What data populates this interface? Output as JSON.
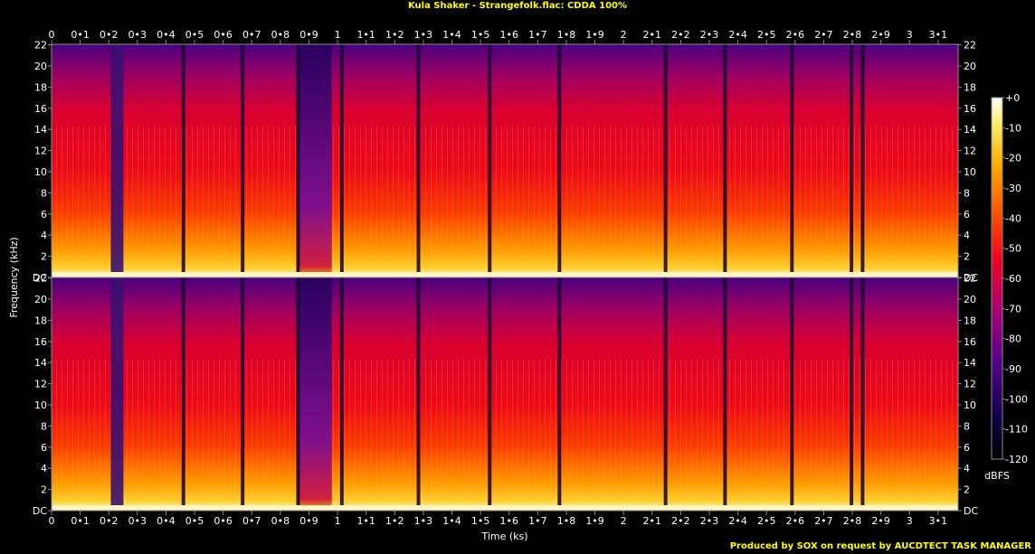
{
  "chart_data": {
    "type": "heatmap",
    "title": "Kula Shaker - Strangefolk.flac: CDDA 100%",
    "xlabel": "Time (ks)",
    "ylabel": "Frequency (kHz)",
    "xlim": [
      0,
      3.17
    ],
    "ylim_khz": [
      0,
      22.05
    ],
    "x_ticks": [
      "0",
      "0•1",
      "0•2",
      "0•3",
      "0•4",
      "0•5",
      "0•6",
      "0•7",
      "0•8",
      "0•9",
      "1",
      "1•1",
      "1•2",
      "1•3",
      "1•4",
      "1•5",
      "1•6",
      "1•7",
      "1•8",
      "1•9",
      "2",
      "2•1",
      "2•2",
      "2•3",
      "2•4",
      "2•5",
      "2•6",
      "2•7",
      "2•8",
      "2•9",
      "3",
      "3•1"
    ],
    "y_ticks": [
      "DC",
      "2",
      "4",
      "6",
      "8",
      "10",
      "12",
      "14",
      "16",
      "18",
      "20",
      "22"
    ],
    "channels": [
      "left",
      "right"
    ],
    "colorbar": {
      "label": "dBFS",
      "ticks": [
        "+0",
        "-10",
        "-20",
        "-30",
        "-40",
        "-50",
        "-60",
        "-70",
        "-80",
        "-90",
        "-100",
        "-110",
        "-120"
      ],
      "range_db": [
        -120,
        0
      ]
    },
    "track_boundaries_ks": [
      0.226,
      0.461,
      0.668,
      0.862,
      1.015,
      1.283,
      1.532,
      1.776,
      2.147,
      2.355,
      2.589,
      2.797,
      2.836
    ]
  },
  "credit": "Produced by SOX on request by AUCDTECT TASK MANAGER",
  "colors": {
    "title": "#ffff00",
    "text": "#ffffff",
    "axis": "#8a8a8a"
  }
}
